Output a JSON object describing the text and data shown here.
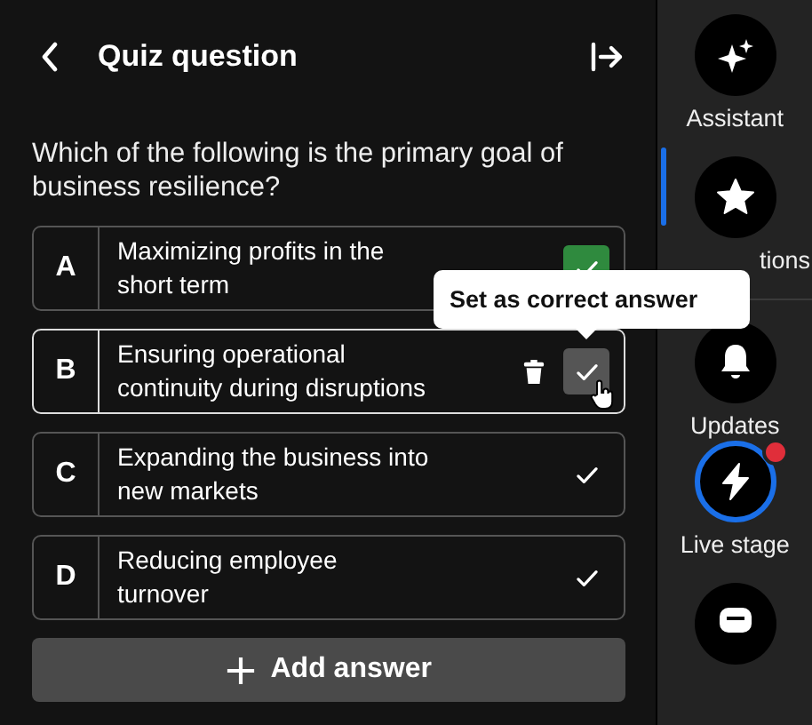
{
  "header": {
    "title": "Quiz question"
  },
  "question": "Which of the following is the primary goal of business resilience?",
  "answers": [
    {
      "letter": "A",
      "text": "Maximizing profits in the short term",
      "correct": true,
      "hovered": false
    },
    {
      "letter": "B",
      "text": "Ensuring operational continuity during disruptions",
      "correct": false,
      "hovered": true
    },
    {
      "letter": "C",
      "text": "Expanding the business into new markets",
      "correct": false,
      "hovered": false
    },
    {
      "letter": "D",
      "text": "Reducing employee turnover",
      "correct": false,
      "hovered": false
    }
  ],
  "tooltip": "Set as correct answer",
  "add_button": "Add answer",
  "rail": [
    {
      "label": "Assistant",
      "selected": false,
      "live": false,
      "notification": false
    },
    {
      "label": "tions",
      "selected": true,
      "live": false,
      "notification": false
    },
    {
      "label": "Updates",
      "selected": false,
      "live": false,
      "notification": false
    },
    {
      "label": "Live stage",
      "selected": false,
      "live": true,
      "notification": true
    },
    {
      "selected": false,
      "live": false,
      "notification": false
    }
  ]
}
